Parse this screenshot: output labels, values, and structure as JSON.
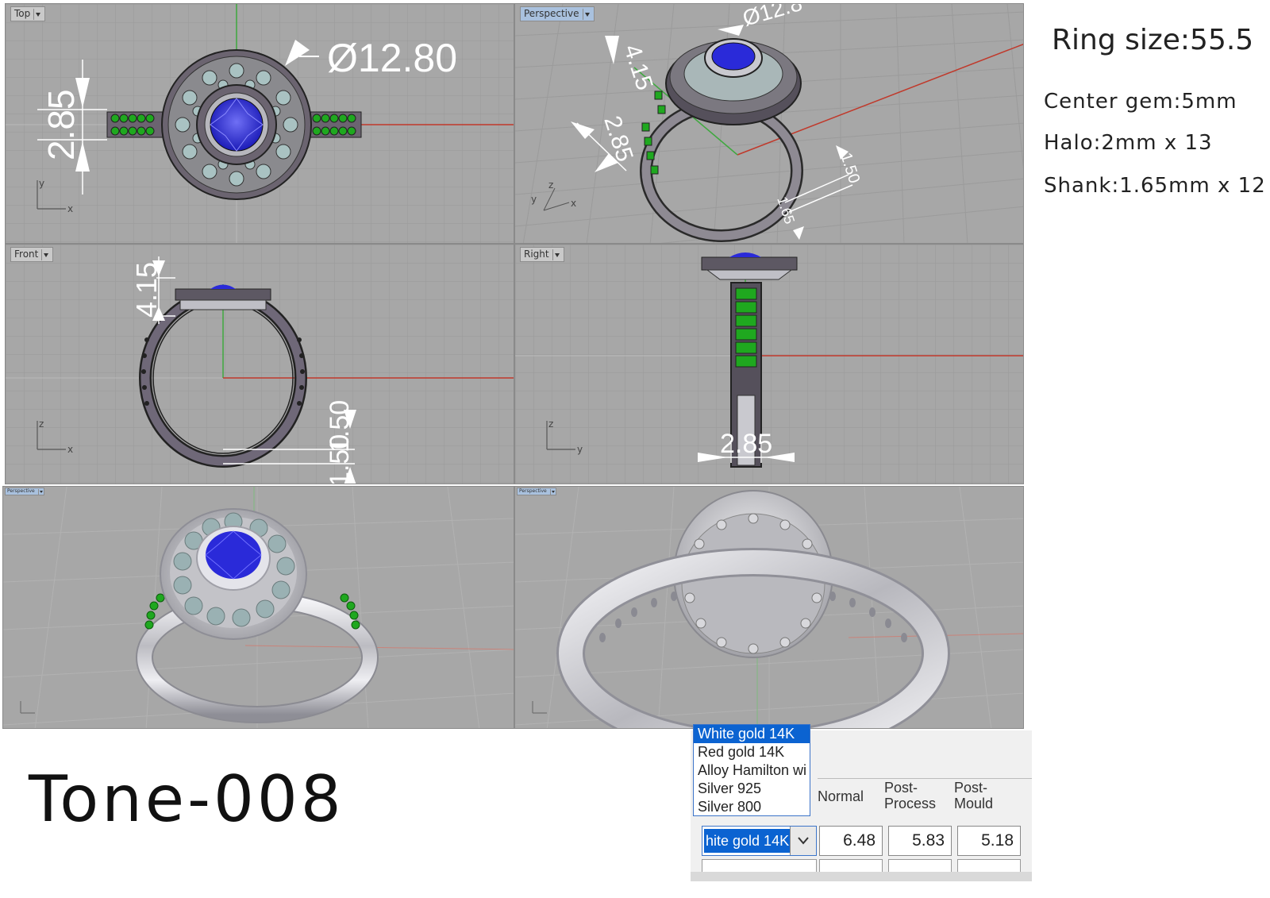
{
  "viewports": {
    "top": {
      "label": "Top",
      "dim_diameter": "Ø12.80",
      "dim_height": "2.85",
      "axis1": "y",
      "axis2": "x"
    },
    "perspective": {
      "label": "Perspective",
      "dim_diameter": "Ø12.8",
      "dim_a": "4.15",
      "dim_b": "2.85",
      "dim_c": "1.50",
      "dim_d": "1.65",
      "axis1": "y",
      "axis2": "z",
      "axis3": "x"
    },
    "front": {
      "label": "Front",
      "dim_height": "4.15",
      "dim_bottom": "1.50",
      "axis1": "z",
      "axis2": "x"
    },
    "right": {
      "label": "Right",
      "dim_width": "2.85",
      "axis1": "z",
      "axis2": "y"
    },
    "render_left": {
      "label": "Perspective"
    },
    "render_right": {
      "label": "Perspective"
    }
  },
  "specs": {
    "ring_size": "Ring size:55.5",
    "center_gem": "Center gem:5mm",
    "halo": "Halo:2mm x 13",
    "shank": "Shank:1.65mm x 12"
  },
  "title": "Tone-008",
  "material_panel": {
    "options": [
      "White gold 14K",
      "Red gold 14K",
      "Alloy Hamilton wi",
      "Silver 925",
      "Silver 800"
    ],
    "selected_value": "hite gold 14K",
    "headers": {
      "normal": "Normal",
      "post_process": "Post-\nProcess",
      "post_mould": "Post-\nMould"
    },
    "values": {
      "normal": "6.48",
      "post_process": "5.83",
      "post_mould": "5.18"
    }
  },
  "colors": {
    "viewport_bg": "#a7a7a7",
    "grid": "#9a9a9a",
    "x_axis": "#c0392b",
    "y_axis": "#3fa83f",
    "center_gem": "#2a2ad9",
    "shank_gems": "#1fa81f",
    "halo_gems": "#a9c2c2",
    "metal": "#7a6e7c",
    "dropdown_highlight": "#0b63d1"
  }
}
